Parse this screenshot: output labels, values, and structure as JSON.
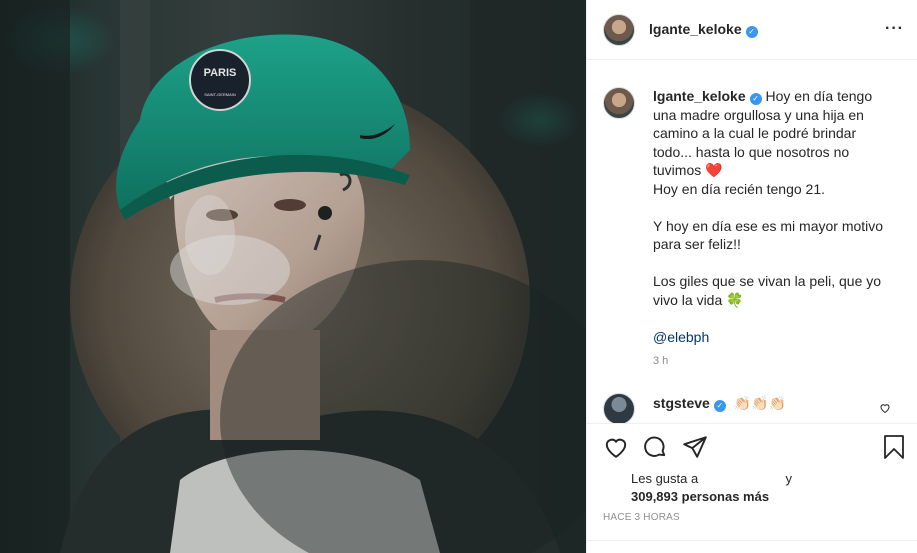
{
  "post": {
    "username": "lgante_keloke",
    "verified_icon": "verified-badge-icon",
    "more_icon": "more-options-icon"
  },
  "photo": {
    "cap_text": "PARIS",
    "cap_subtext": "SAINT-GERMAIN",
    "colors": {
      "cap": "#169a84",
      "background": "#2c3a38",
      "fur": "#6b5f52"
    }
  },
  "caption": {
    "username": "lgante_keloke",
    "line1": "Hoy en día tengo una madre orgullosa y una hija en camino a la cual le podré brindar todo... hasta lo que nosotros no tuvimos",
    "heart_emoji": "❤️",
    "line2": "Hoy en día recién tengo 21.",
    "line3": "Y hoy en día ese es mi mayor motivo para ser feliz!!",
    "line4": "Los giles que se vivan la peli, que yo vivo la vida",
    "clover_emoji": "🍀",
    "mention": "@elebph",
    "time": "3 h"
  },
  "comment": {
    "username": "stgsteve",
    "emojis": "👏🏻👏🏻👏🏻"
  },
  "actions": {
    "like_icon": "heart-icon",
    "comment_icon": "comment-icon",
    "share_icon": "share-icon",
    "save_icon": "bookmark-icon"
  },
  "likes": {
    "prefix": "Les gusta a",
    "conjunction": "y",
    "count": "309,893",
    "suffix": "personas más"
  },
  "posted": "HACE 3 HORAS"
}
